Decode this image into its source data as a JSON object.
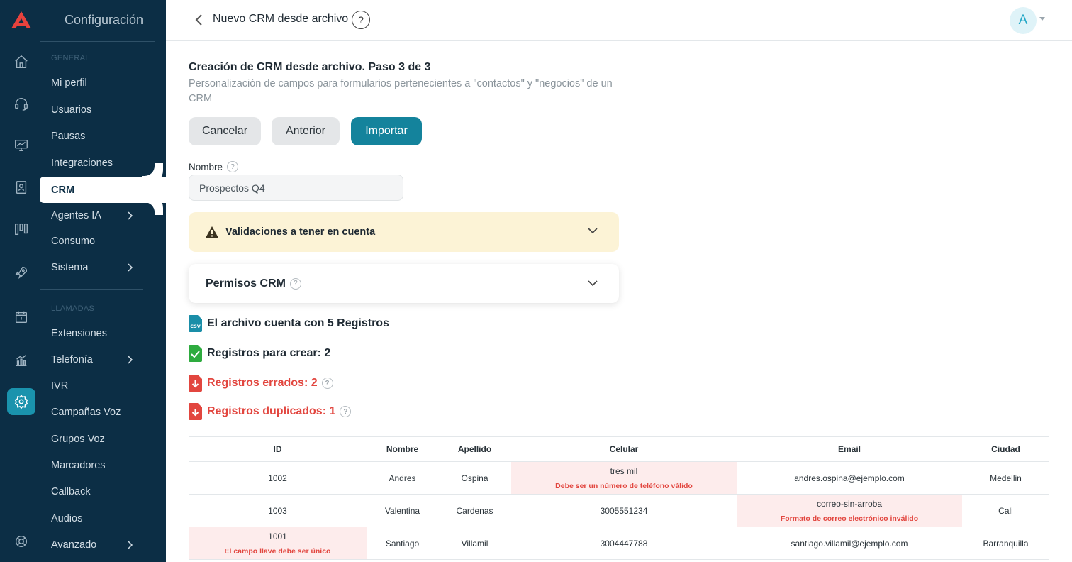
{
  "sidebar": {
    "title": "Configuración",
    "sections": {
      "general": "GENERAL",
      "llamadas": "LLAMADAS"
    },
    "items": [
      {
        "label": "Mi perfil"
      },
      {
        "label": "Usuarios"
      },
      {
        "label": "Pausas"
      },
      {
        "label": "Integraciones"
      },
      {
        "label": "CRM"
      },
      {
        "label": "Agentes IA"
      },
      {
        "label": "Consumo"
      },
      {
        "label": "Sistema"
      },
      {
        "label": "Extensiones"
      },
      {
        "label": "Telefonía"
      },
      {
        "label": "IVR"
      },
      {
        "label": "Campañas Voz"
      },
      {
        "label": "Grupos Voz"
      },
      {
        "label": "Marcadores"
      },
      {
        "label": "Callback"
      },
      {
        "label": "Audios"
      },
      {
        "label": "Avanzado"
      }
    ],
    "rail_icons": [
      "home-icon",
      "headset-icon",
      "monitor-icon",
      "contacts-book-icon",
      "kanban-icon",
      "rocket-icon",
      "calendar-icon",
      "analytics-icon",
      "settings-icon",
      "help-lifebuoy-icon"
    ],
    "active_item": "CRM",
    "active_rail": "settings-icon"
  },
  "header": {
    "title": "Nuevo CRM desde archivo",
    "help": "?",
    "avatar_initial": "A"
  },
  "main": {
    "step_title": "Creación de CRM desde archivo. Paso 3 de 3",
    "step_subtitle": "Personalización de campos para formularios pertenecientes a \"contactos\" y \"negocios\" de un CRM",
    "buttons": {
      "cancel": "Cancelar",
      "previous": "Anterior",
      "import": "Importar"
    },
    "name_label": "Nombre",
    "name_value": "Prospectos Q4",
    "warning": "Validaciones a tener en cuenta",
    "permissions": "Permisos CRM",
    "stats": {
      "total": "El archivo cuenta con 5 Registros",
      "to_create": "Registros para crear: 2",
      "errors": "Registros errados: 2",
      "duplicates": "Registros duplicados: 1"
    }
  },
  "table": {
    "columns": [
      "ID",
      "Nombre",
      "Apellido",
      "Celular",
      "Email",
      "Ciudad"
    ],
    "rows": [
      {
        "id": "1002",
        "nombre": "Andres",
        "apellido": "Ospina",
        "celular": "tres mil",
        "celular_error": "Debe ser un número de teléfono válido",
        "email": "andres.ospina@ejemplo.com",
        "email_error": "",
        "ciudad": "Medellin",
        "id_error": ""
      },
      {
        "id": "1003",
        "nombre": "Valentina",
        "apellido": "Cardenas",
        "celular": "3005551234",
        "celular_error": "",
        "email": "correo-sin-arroba",
        "email_error": "Formato de correo electrónico inválido",
        "ciudad": "Cali",
        "id_error": ""
      },
      {
        "id": "1001",
        "nombre": "Santiago",
        "apellido": "Villamil",
        "celular": "3004447788",
        "celular_error": "",
        "email": "santiago.villamil@ejemplo.com",
        "email_error": "",
        "ciudad": "Barranquilla",
        "id_error": "El campo llave debe ser único"
      }
    ]
  },
  "colors": {
    "sidebar_bg": "#0c2e45",
    "primary": "#14839c",
    "error": "#e2463f",
    "warning_bg": "#fcf3d6",
    "error_cell_bg": "#fdecec"
  }
}
